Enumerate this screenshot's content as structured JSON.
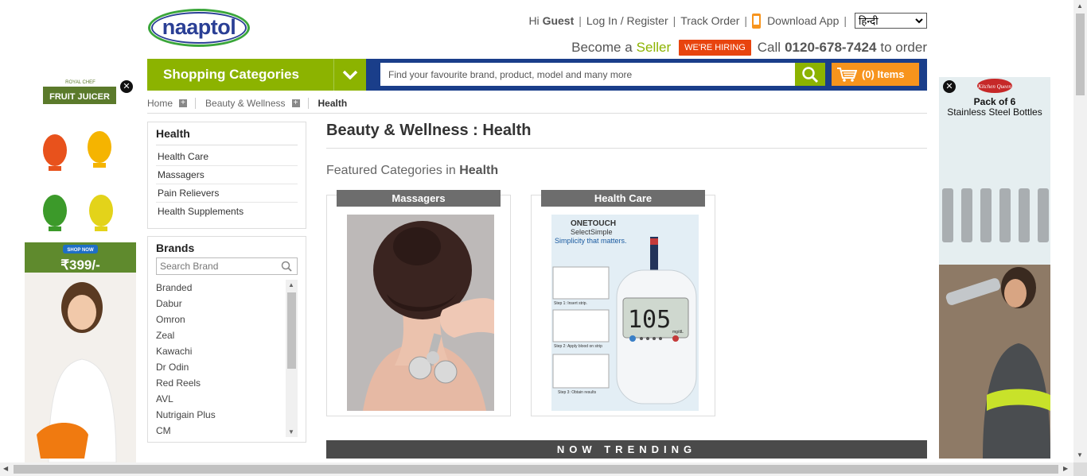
{
  "header": {
    "logo_text": "naaptol",
    "greeting": "Hi",
    "guest": "Guest",
    "login": "Log In / Register",
    "track_order": "Track Order",
    "download_app": "Download App",
    "language_selected": "हिन्दी",
    "become_a": "Become a",
    "seller": "Seller",
    "hiring": "WE'RE HIRING",
    "call": "Call",
    "phone": "0120-678-7424",
    "to_order": "to order"
  },
  "navbar": {
    "shopping_categories": "Shopping Categories",
    "search_placeholder": "Find your favourite brand, product, model and many more",
    "cart_label": "(0) Items"
  },
  "breadcrumb": {
    "home": "Home",
    "beauty": "Beauty & Wellness",
    "current": "Health"
  },
  "sidebar": {
    "health_title": "Health",
    "health_items": [
      "Health Care",
      "Massagers",
      "Pain Relievers",
      "Health Supplements"
    ],
    "brands_title": "Brands",
    "brand_search_placeholder": "Search Brand",
    "brands": [
      "Branded",
      "Dabur",
      "Omron",
      "Zeal",
      "Kawachi",
      "Dr Odin",
      "Red Reels",
      "AVL",
      "Nutrigain Plus",
      "CM"
    ]
  },
  "main": {
    "title": "Beauty & Wellness : Health",
    "featured_prefix": "Featured Categories in",
    "featured_category": "Health",
    "cards": [
      {
        "label": "Massagers"
      },
      {
        "label": "Health Care"
      }
    ],
    "device_brand": "ONETOUCH",
    "device_model": "SelectSimple",
    "device_tagline": "Simplicity that matters.",
    "device_reading": "105",
    "device_unit": "mg/dL",
    "device_steps": [
      "Step 1: Insert strip.",
      "Step 2: Apply blood on strip",
      "Step 3: Obtain results"
    ],
    "trending": "NOW TRENDING"
  },
  "ads": {
    "left_brand": "ROYAL CHEF",
    "left_title": "FRUIT JUICER",
    "left_cta": "SHOP NOW",
    "left_price": "₹399/-",
    "right_brand": "Kitchen Queen",
    "right_title_line1": "Pack of 6",
    "right_title_line2": "Stainless Steel Bottles"
  },
  "colors": {
    "brand_green": "#8cb300",
    "brand_blue": "#1a3e8a",
    "cart_orange": "#f7941d",
    "hiring_red": "#e8440e"
  }
}
